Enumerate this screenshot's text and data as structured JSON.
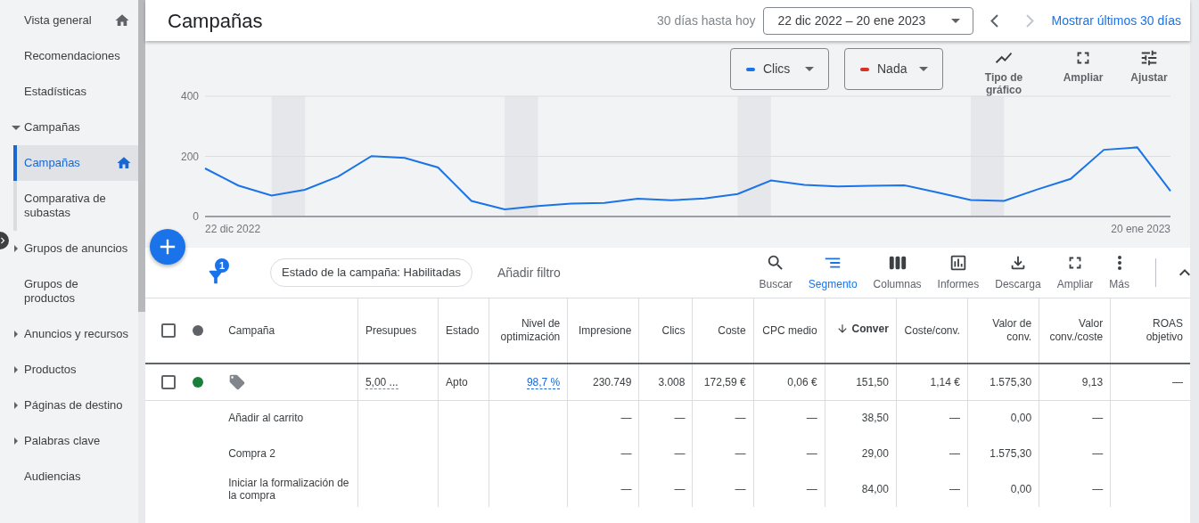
{
  "sidebar": {
    "items": [
      {
        "label": "Vista general",
        "kind": "link",
        "pinned": true,
        "selected": false
      },
      {
        "label": "Recomendaciones",
        "kind": "link",
        "pinned": false,
        "selected": false
      },
      {
        "label": "Estadísticas",
        "kind": "link",
        "pinned": false,
        "selected": false
      },
      {
        "label": "Campañas",
        "kind": "group",
        "expanded": true,
        "pinned": false,
        "selected": false,
        "children": [
          {
            "label": "Campañas",
            "kind": "link",
            "pinned": true,
            "selected": true
          },
          {
            "label": "Comparativa de subastas",
            "kind": "link",
            "pinned": false,
            "selected": false
          }
        ]
      },
      {
        "label": "Grupos de anuncios",
        "kind": "group",
        "expanded": false,
        "pinned": false,
        "selected": false
      },
      {
        "label": "Grupos de productos",
        "kind": "link",
        "pinned": false,
        "selected": false
      },
      {
        "label": "Anuncios y recursos",
        "kind": "group",
        "expanded": false,
        "pinned": false,
        "selected": false
      },
      {
        "label": "Productos",
        "kind": "group",
        "expanded": false,
        "pinned": false,
        "selected": false
      },
      {
        "label": "Páginas de destino",
        "kind": "group",
        "expanded": false,
        "pinned": false,
        "selected": false
      },
      {
        "label": "Palabras clave",
        "kind": "group",
        "expanded": false,
        "pinned": false,
        "selected": false
      },
      {
        "label": "Audiencias",
        "kind": "link",
        "pinned": false,
        "selected": false
      }
    ]
  },
  "header": {
    "title": "Campañas",
    "range_hint": "30 días hasta hoy",
    "date_range": "22 dic 2022 – 20 ene 2023",
    "nav": [
      {
        "kind": "prev",
        "disabled": false
      },
      {
        "kind": "next",
        "disabled": true
      }
    ],
    "link": "Mostrar últimos 30 días"
  },
  "chart": {
    "metrics": [
      {
        "label": "Clics",
        "color": "#1a73e8"
      },
      {
        "label": "Nada",
        "color": "#d93025"
      }
    ],
    "tools": [
      {
        "kind": "chart-type",
        "label": "Tipo de gráfico"
      },
      {
        "kind": "expand",
        "label": "Ampliar"
      },
      {
        "kind": "adjust",
        "label": "Ajustar"
      }
    ],
    "date_labels": [
      "22 dic 2022",
      "20 ene 2023"
    ],
    "chart_data": {
      "type": "line",
      "ylim": [
        0,
        400
      ],
      "yticks": [
        0,
        200,
        400
      ],
      "series": [
        {
          "color": "#1a73e8",
          "values": [
            160,
            103,
            70,
            89,
            133,
            201,
            195,
            163,
            52,
            24,
            35,
            43,
            45,
            59,
            54,
            60,
            75,
            120,
            105,
            100,
            102,
            104,
            80,
            55,
            52,
            90,
            125,
            222,
            230,
            85
          ]
        }
      ]
    }
  },
  "filters": {
    "count": "1",
    "chips": [
      "Estado de la campaña: Habilitadas"
    ],
    "add_label": "Añadir filtro"
  },
  "toolbar": [
    {
      "kind": "search",
      "label": "Buscar",
      "selected": false
    },
    {
      "kind": "segment",
      "label": "Segmento",
      "selected": true
    },
    {
      "kind": "columns",
      "label": "Columnas",
      "selected": false
    },
    {
      "kind": "reports",
      "label": "Informes",
      "selected": false
    },
    {
      "kind": "download",
      "label": "Descarga",
      "selected": false
    },
    {
      "kind": "expand",
      "label": "Ampliar",
      "selected": false
    },
    {
      "kind": "more",
      "label": "Más",
      "selected": false
    }
  ],
  "table": {
    "header_checked": false,
    "columns": [
      {
        "label": "Campaña",
        "kind": "text",
        "sorted": false
      },
      {
        "label": "Presupues",
        "kind": "text",
        "sorted": false
      },
      {
        "label": "Estado",
        "kind": "text",
        "sorted": false
      },
      {
        "label": "Nivel de optimización",
        "kind": "number",
        "sorted": false
      },
      {
        "label": "Impresione",
        "kind": "number",
        "sorted": false
      },
      {
        "label": "Clics",
        "kind": "number",
        "sorted": false
      },
      {
        "label": "Coste",
        "kind": "number",
        "sorted": false
      },
      {
        "label": "CPC medio",
        "kind": "number",
        "sorted": false
      },
      {
        "label": "Conver",
        "kind": "number",
        "sorted": true
      },
      {
        "label": "Coste/conv.",
        "kind": "number",
        "sorted": false
      },
      {
        "label": "Valor de conv.",
        "kind": "number",
        "sorted": false
      },
      {
        "label": "Valor conv./coste",
        "kind": "number",
        "sorted": false
      },
      {
        "label": "ROAS objetivo",
        "kind": "number",
        "sorted": false
      }
    ],
    "rows": [
      {
        "kind": "campaign",
        "checked": false,
        "color": "#188038",
        "cells": [
          null,
          {
            "text": "5,00 ...",
            "kind": "underlined"
          },
          "Apto",
          {
            "text": "98,7 %",
            "kind": "link"
          },
          "230.749",
          "3.008",
          "172,59 €",
          "0,06 €",
          "151,50",
          "1,14 €",
          "1.575,30",
          "9,13",
          "—"
        ]
      },
      {
        "kind": "segment",
        "cells": [
          "Añadir al carrito",
          null,
          null,
          null,
          "—",
          "—",
          "—",
          "—",
          "38,50",
          "—",
          "0,00",
          "—",
          null
        ]
      },
      {
        "kind": "segment",
        "cells": [
          "Compra 2",
          null,
          null,
          null,
          "—",
          "—",
          "—",
          "—",
          "29,00",
          "—",
          "1.575,30",
          "—",
          null
        ]
      },
      {
        "kind": "segment",
        "cells": [
          "Iniciar la formalización de la compra",
          null,
          null,
          null,
          "—",
          "—",
          "—",
          "—",
          "84,00",
          "—",
          "0,00",
          "—",
          null
        ]
      }
    ]
  }
}
